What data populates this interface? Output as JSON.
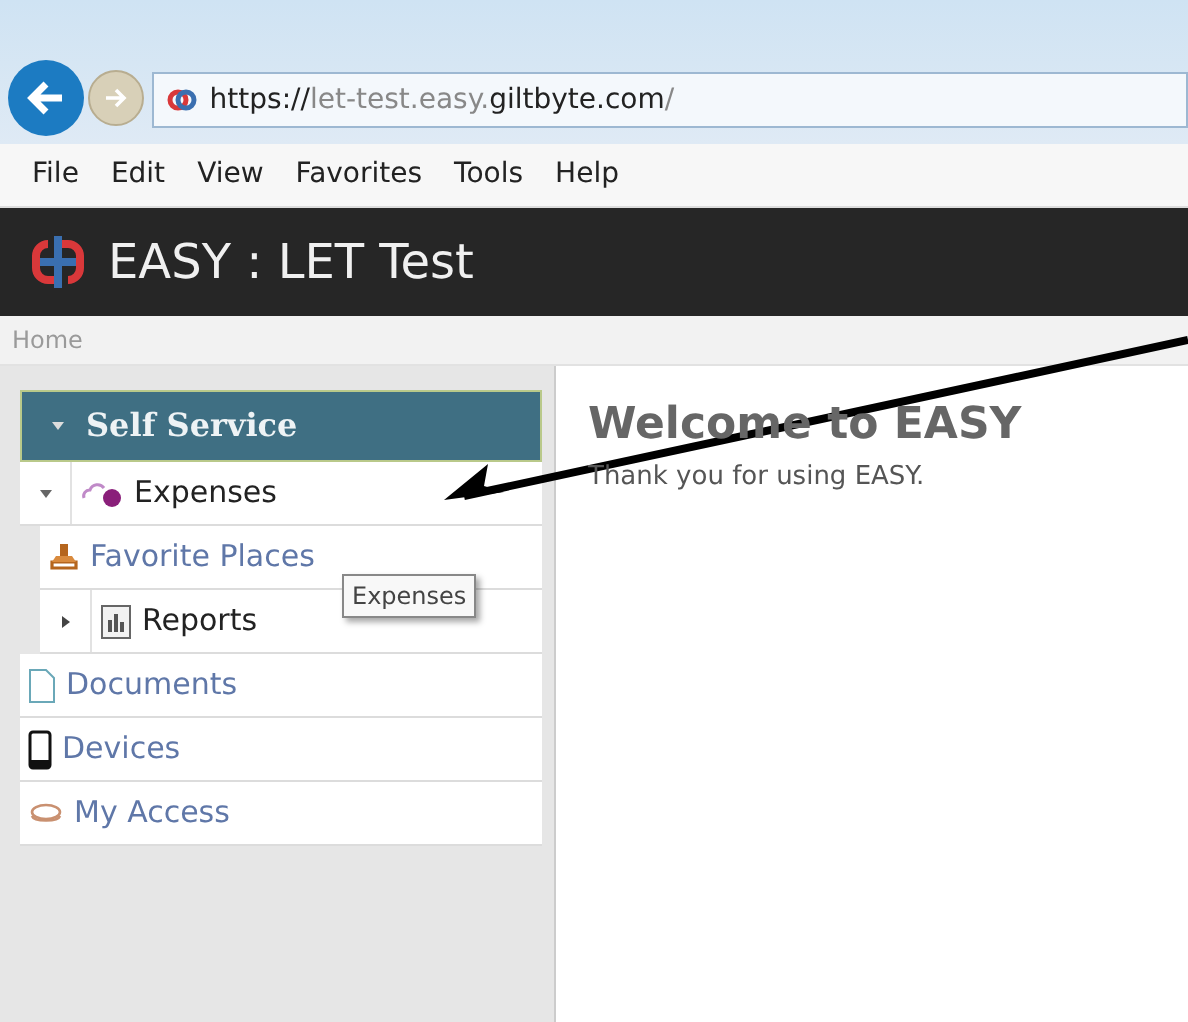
{
  "browser": {
    "address_parts": [
      {
        "text": "https://",
        "strong": true
      },
      {
        "text": "let-test.easy.",
        "strong": false
      },
      {
        "text": "giltbyte.com",
        "strong": true
      },
      {
        "text": "/",
        "strong": false
      }
    ],
    "menu": [
      "File",
      "Edit",
      "View",
      "Favorites",
      "Tools",
      "Help"
    ]
  },
  "app": {
    "title": "EASY : LET Test",
    "breadcrumb": "Home"
  },
  "sidebar": {
    "section": {
      "label": "Self Service",
      "expanded": true
    },
    "items": [
      {
        "label": "Expenses",
        "expanded": true,
        "children": [
          {
            "label": "Favorite Places"
          },
          {
            "label": "Reports",
            "expanded": false
          }
        ]
      },
      {
        "label": "Documents"
      },
      {
        "label": "Devices"
      },
      {
        "label": "My Access"
      }
    ]
  },
  "tooltip": "Expenses",
  "content": {
    "heading": "Welcome to EASY",
    "text": "Thank you for using EASY."
  }
}
